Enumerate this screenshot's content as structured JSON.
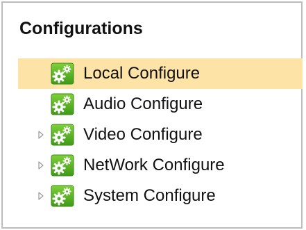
{
  "panel": {
    "title": "Configurations"
  },
  "tree": {
    "accent_selected": "#fde4a6",
    "items": [
      {
        "label": "Local Configure",
        "icon": "gear-icon",
        "expandable": false,
        "selected": true
      },
      {
        "label": "Audio Configure",
        "icon": "gear-icon",
        "expandable": false,
        "selected": false
      },
      {
        "label": "Video Configure",
        "icon": "gear-icon",
        "expandable": true,
        "selected": false
      },
      {
        "label": "NetWork Configure",
        "icon": "gear-icon",
        "expandable": true,
        "selected": false
      },
      {
        "label": "System Configure",
        "icon": "gear-icon",
        "expandable": true,
        "selected": false
      }
    ]
  }
}
